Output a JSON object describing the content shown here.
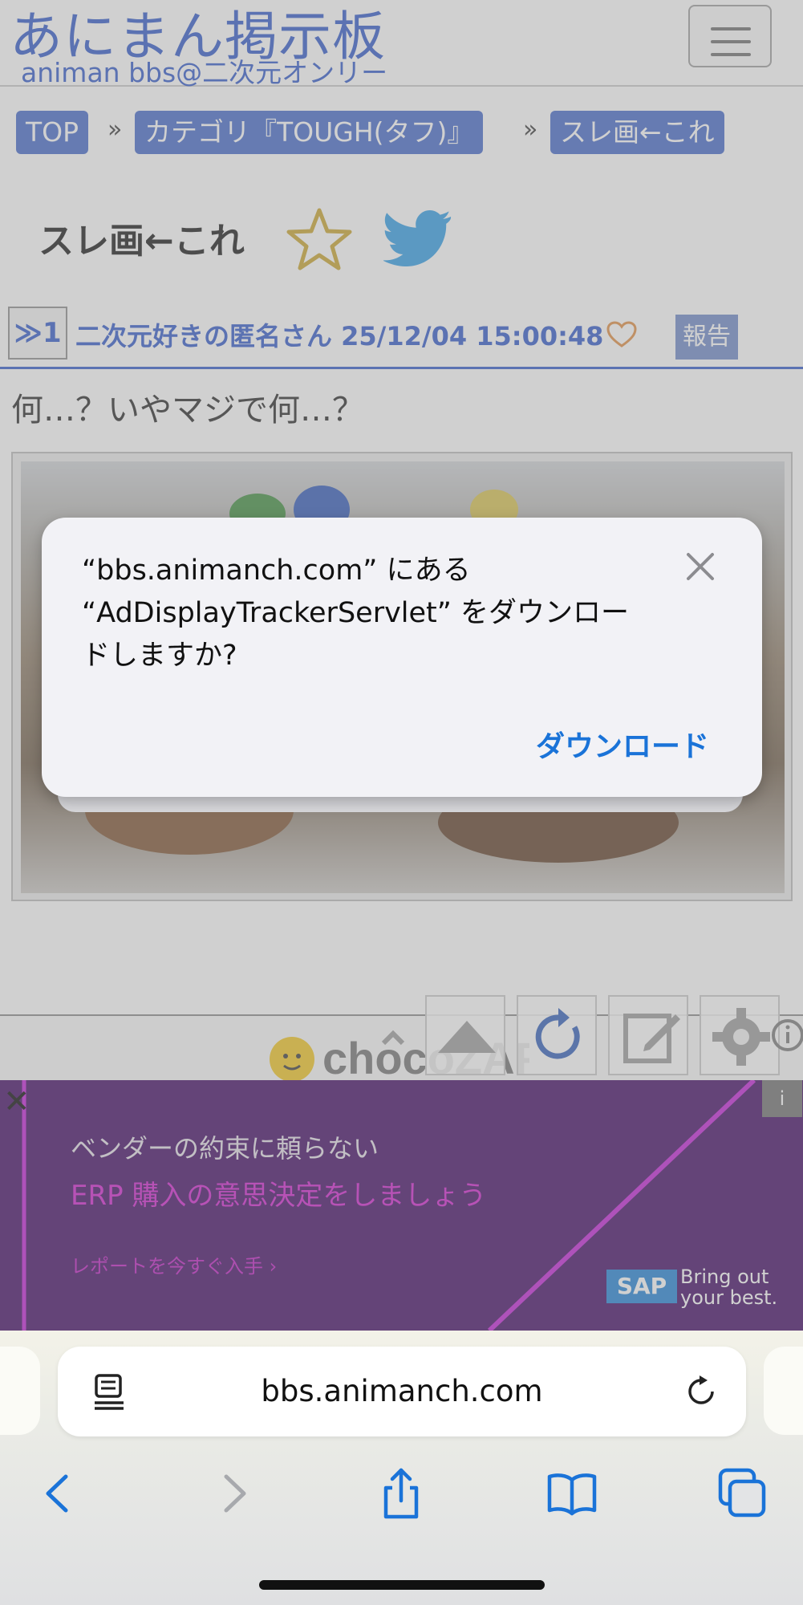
{
  "site": {
    "title": "あにまん掲示板",
    "subtitle": "animan bbs@二次元オンリー"
  },
  "breadcrumb": {
    "items": [
      "TOP",
      "カテゴリ『TOUGH(タフ)』",
      "スレ画←これ"
    ],
    "separator": "»"
  },
  "thread": {
    "title": "スレ画←これ"
  },
  "post": {
    "number": "≫1",
    "author_line": "二次元好きの匿名さん 25/12/04 15:00:48",
    "report_label": "報告",
    "body": "何…？いやマジで何…？"
  },
  "ad_strip": {
    "brand": "chocoZAP"
  },
  "sap_ad": {
    "line1": "ベンダーの約束に頼らない",
    "line2": "ERP 購入の意思決定をしましょう",
    "line3": "レポートを今すぐ入手 ›",
    "logo": "SAP",
    "tagline1": "Bring out",
    "tagline2": "your best.",
    "info": "i",
    "close": "✕"
  },
  "dialog": {
    "message": "“bbs.animanch.com” にある\n“AdDisplayTrackerServlet” をダウンロー\nドしますか?",
    "action_label": "ダウンロード"
  },
  "browser": {
    "url": "bbs.animanch.com"
  },
  "colors": {
    "accent": "#2a54c8",
    "dialog_action": "#1a73d8",
    "ad_purple": "#3b0060"
  }
}
